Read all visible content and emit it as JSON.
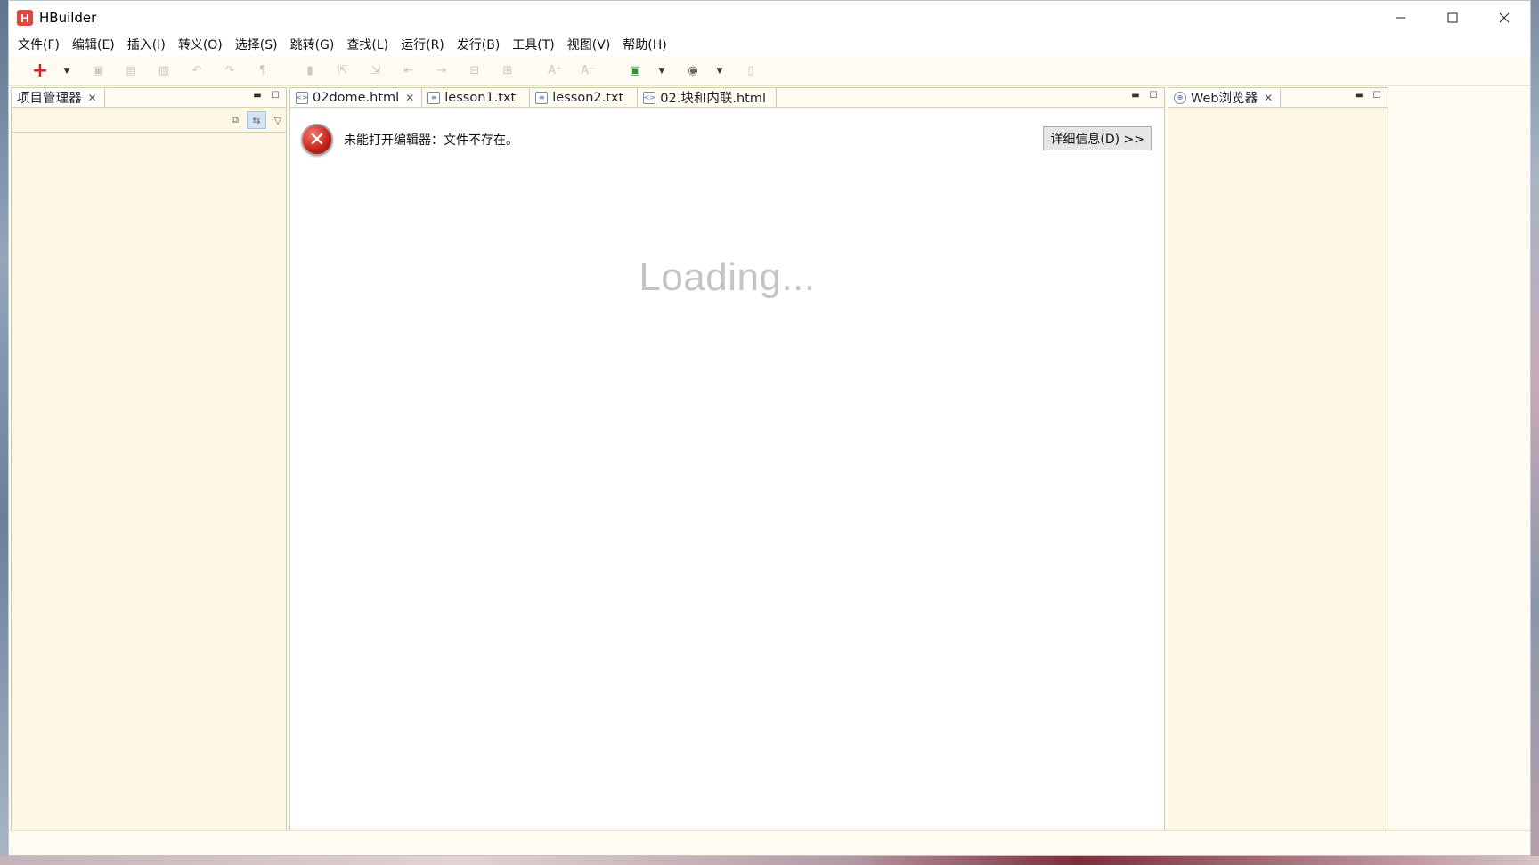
{
  "window": {
    "title": "HBuilder",
    "logo_letter": "H",
    "controls": {
      "minimize": "—",
      "maximize": "☐",
      "close": "✕"
    }
  },
  "menubar": {
    "items": [
      {
        "label": "文件(F)"
      },
      {
        "label": "编辑(E)"
      },
      {
        "label": "插入(I)"
      },
      {
        "label": "转义(O)"
      },
      {
        "label": "选择(S)"
      },
      {
        "label": "跳转(G)"
      },
      {
        "label": "查找(L)"
      },
      {
        "label": "运行(R)"
      },
      {
        "label": "发行(B)"
      },
      {
        "label": "工具(T)"
      },
      {
        "label": "视图(V)"
      },
      {
        "label": "帮助(H)"
      }
    ]
  },
  "toolbar": {
    "new_icon": "+",
    "icons": [
      "save-icon",
      "save-all-icon",
      "print-icon",
      "undo-icon",
      "redo-icon",
      "format-icon",
      "bookmark-icon",
      "import-icon",
      "export-icon",
      "prev-icon",
      "next-icon",
      "collapse-icon",
      "expand-icon",
      "font-increase-icon",
      "font-decrease-icon",
      "run-icon",
      "browser-icon",
      "help-icon"
    ]
  },
  "project_panel": {
    "tab_label": "项目管理器"
  },
  "editor": {
    "tabs": [
      {
        "label": "02dome.html",
        "icon": "html-file-icon",
        "selected": true
      },
      {
        "label": "lesson1.txt",
        "icon": "text-file-icon",
        "selected": false
      },
      {
        "label": "lesson2.txt",
        "icon": "text-file-icon",
        "selected": false
      },
      {
        "label": "02.块和内联.html",
        "icon": "html-file-icon",
        "selected": false
      }
    ],
    "error_message": "未能打开编辑器：文件不存在。",
    "details_button": "详细信息(D) >>",
    "loading_text": "Loading..."
  },
  "browser_panel": {
    "tab_label": "Web浏览器"
  },
  "colors": {
    "accent_red": "#d6261e",
    "panel_bg": "#fdf8e6",
    "editor_bg": "#ffffff"
  }
}
